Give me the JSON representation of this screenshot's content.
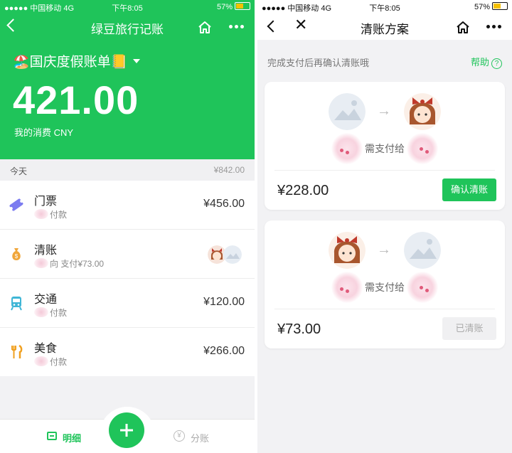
{
  "left": {
    "status": {
      "carrier": "●●●●● 中国移动",
      "network": "4G",
      "time": "下午8:05",
      "battery": "57%"
    },
    "nav": {
      "title": "绿豆旅行记账"
    },
    "bill": {
      "name": "🏖️国庆度假账单📒",
      "amount": "421.00",
      "spend_label": "我的消费 CNY"
    },
    "day": {
      "label": "今天",
      "total": "¥842.00"
    },
    "items": [
      {
        "title": "门票",
        "sub": "付款",
        "amount": "¥456.00",
        "icon": "ticket-icon"
      },
      {
        "title": "清账",
        "sub": "向   支付¥73.00",
        "amount": "",
        "icon": "money-bag-icon"
      },
      {
        "title": "交通",
        "sub": "付款",
        "amount": "¥120.00",
        "icon": "train-icon"
      },
      {
        "title": "美食",
        "sub": "付款",
        "amount": "¥266.00",
        "icon": "fork-knife-icon"
      }
    ],
    "tabs": {
      "detail": "明细",
      "split": "分账",
      "split_icon_glyph": "¥"
    },
    "colors": {
      "brand": "#1fc45a"
    }
  },
  "right": {
    "status": {
      "carrier": "●●●●● 中国移动",
      "network": "4G",
      "time": "下午8:05",
      "battery": "57%"
    },
    "nav": {
      "title": "清账方案"
    },
    "hint": "完成支付后再确认清账哦",
    "help": "帮助",
    "cards": [
      {
        "pay_label": "需支付给",
        "amount": "¥228.00",
        "button": "确认清账"
      },
      {
        "pay_label": "需支付给",
        "amount": "¥73.00",
        "button": "已清账"
      }
    ]
  }
}
